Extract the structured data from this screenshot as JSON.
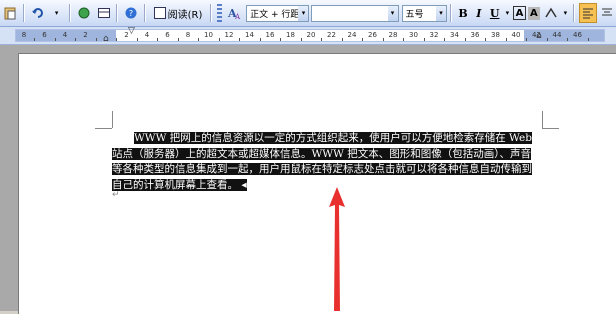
{
  "toolbar": {
    "read_label": "阅读(R)",
    "style_value": "正文 + 行距",
    "font_value": "",
    "size_value": "五号",
    "bold_label": "B",
    "italic_label": "I",
    "underline_label": "U",
    "char_border_label": "A",
    "char_shade_label": "A"
  },
  "ruler": {
    "labels": [
      "8",
      "6",
      "4",
      "2",
      "",
      "2",
      "4",
      "6",
      "8",
      "10",
      "12",
      "14",
      "16",
      "18",
      "20",
      "22",
      "24",
      "26",
      "28",
      "30",
      "32",
      "34",
      "36",
      "38",
      "40",
      "42",
      "44",
      "46"
    ]
  },
  "document": {
    "lines": [
      "WWW 把网上的信息资源以一定的方式组织起来，使用户可以方便地检索存储在 Web",
      "站点（服务器）上的超文本或超媒体信息。WWW 把文本、图形和图像（包括动画）、声音",
      "等各种类型的信息集成到一起，用户用鼠标在特定标志处点击就可以将各种信息自动传输到",
      "自己的计算机屏幕上查看。"
    ],
    "end_mark": "↵"
  },
  "colors": {
    "selection": "#111111",
    "annotation_arrow": "#e8312f"
  }
}
